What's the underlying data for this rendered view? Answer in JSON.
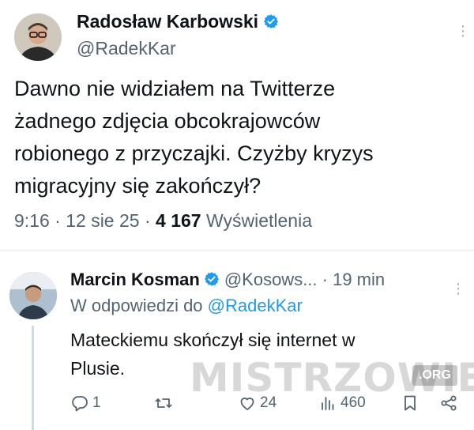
{
  "main_tweet": {
    "display_name": "Radosław Karbowski",
    "handle": "@RadekKar",
    "text": "Dawno nie widziałem na Twitterze\nżadnego zdjęcia obcokrajowców\nrobionego z przyczajki. Czyżby kryzys\nmigracyjny się zakończył?",
    "time": "9:16",
    "date": "12 sie 25",
    "views_count": "4 167",
    "views_label": "Wyświetlenia"
  },
  "reply": {
    "display_name": "Marcin Kosman",
    "handle": "@Kosows...",
    "time": "· 19 min",
    "replying_to_label": "W odpowiedzi do",
    "replying_to_handle": "@RadekKar",
    "text": "Mateckiemu skończył się internet w\nPlusie.",
    "stats": {
      "replies": "1",
      "retweets": "",
      "likes": "24",
      "views": "460"
    }
  },
  "watermark": {
    "text": "MISTRZOWIE",
    "suffix": ".ORG"
  },
  "colors": {
    "verified": "#1d9bf0",
    "link": "#1d9bf0",
    "secondary": "#536471",
    "primary": "#0f1419"
  },
  "icons": [
    "verified-badge-icon",
    "more-icon",
    "reply-icon",
    "retweet-icon",
    "like-icon",
    "views-icon",
    "bookmark-icon",
    "share-icon"
  ]
}
